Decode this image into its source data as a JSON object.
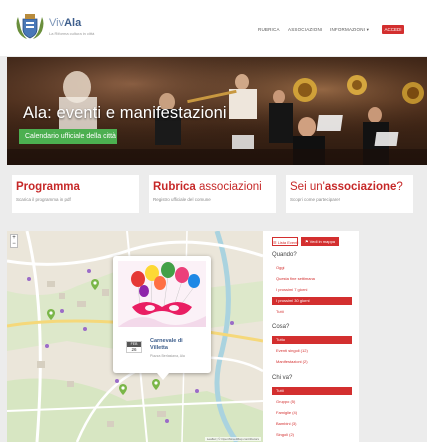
{
  "header": {
    "logo_prefix": "Viv",
    "logo_name": "Ala",
    "logo_subtitle": "La Riforma cultura in città",
    "nav": [
      {
        "label": "RUBRICA"
      },
      {
        "label": "ASSOCIAZIONI"
      },
      {
        "label": "INFORMAZIONI ▾"
      }
    ],
    "accedi_label": "ACCEDI"
  },
  "hero": {
    "title": "Ala: eventi e manifestazioni",
    "badge": "Calendario ufficiale della città"
  },
  "cards": [
    {
      "title_bold": "Programma",
      "title_light": "",
      "title_suffix": "",
      "subtitle": "Scarica il programma in pdf"
    },
    {
      "title_bold": "Rubrica",
      "title_light": " associazioni",
      "title_suffix": "",
      "subtitle": "Registro ufficiale del comune"
    },
    {
      "title_light": "Sei un'",
      "title_bold": "associazione",
      "title_suffix": "?",
      "subtitle": "Scopri come partecipare!"
    }
  ],
  "map": {
    "zoom_in": "+",
    "zoom_out": "−",
    "attribution": "Leaflet | © OpenStreetMap contributors",
    "popup": {
      "month": "FEB",
      "day": "26",
      "title_line1": "Carnevale di",
      "title_line2": "Villetta",
      "place": "Piazza Berlasiana, Ala"
    },
    "colors": {
      "road": "#ffffff",
      "water": "#aad3df",
      "park": "#cfe6b8",
      "marker": "#7ab648"
    }
  },
  "filters": {
    "list_button": "☰ Lista Eventi",
    "map_button": "⚑ Vedi in mappa",
    "quando": {
      "title": "Quando?",
      "options": [
        {
          "label": "Oggi",
          "active": false
        },
        {
          "label": "Questa fine settimana",
          "active": false
        },
        {
          "label": "I prossimi 7 giorni",
          "active": false
        },
        {
          "label": "I prossimi 30 giorni",
          "active": true
        },
        {
          "label": "Tutti",
          "active": false
        }
      ]
    },
    "cosa": {
      "title": "Cosa?",
      "options": [
        {
          "label": "Tutto",
          "active": true
        },
        {
          "label": "Eventi singoli (12)",
          "active": false
        },
        {
          "label": "Manifestazioni (2)",
          "active": false
        }
      ]
    },
    "chi": {
      "title": "Chi va?",
      "options": [
        {
          "label": "Tutti",
          "active": true
        },
        {
          "label": "Gruppo (5)",
          "active": false
        },
        {
          "label": "Famiglie (4)",
          "active": false
        },
        {
          "label": "Bambini (3)",
          "active": false
        },
        {
          "label": "Singoli (2)",
          "active": false
        }
      ]
    }
  }
}
